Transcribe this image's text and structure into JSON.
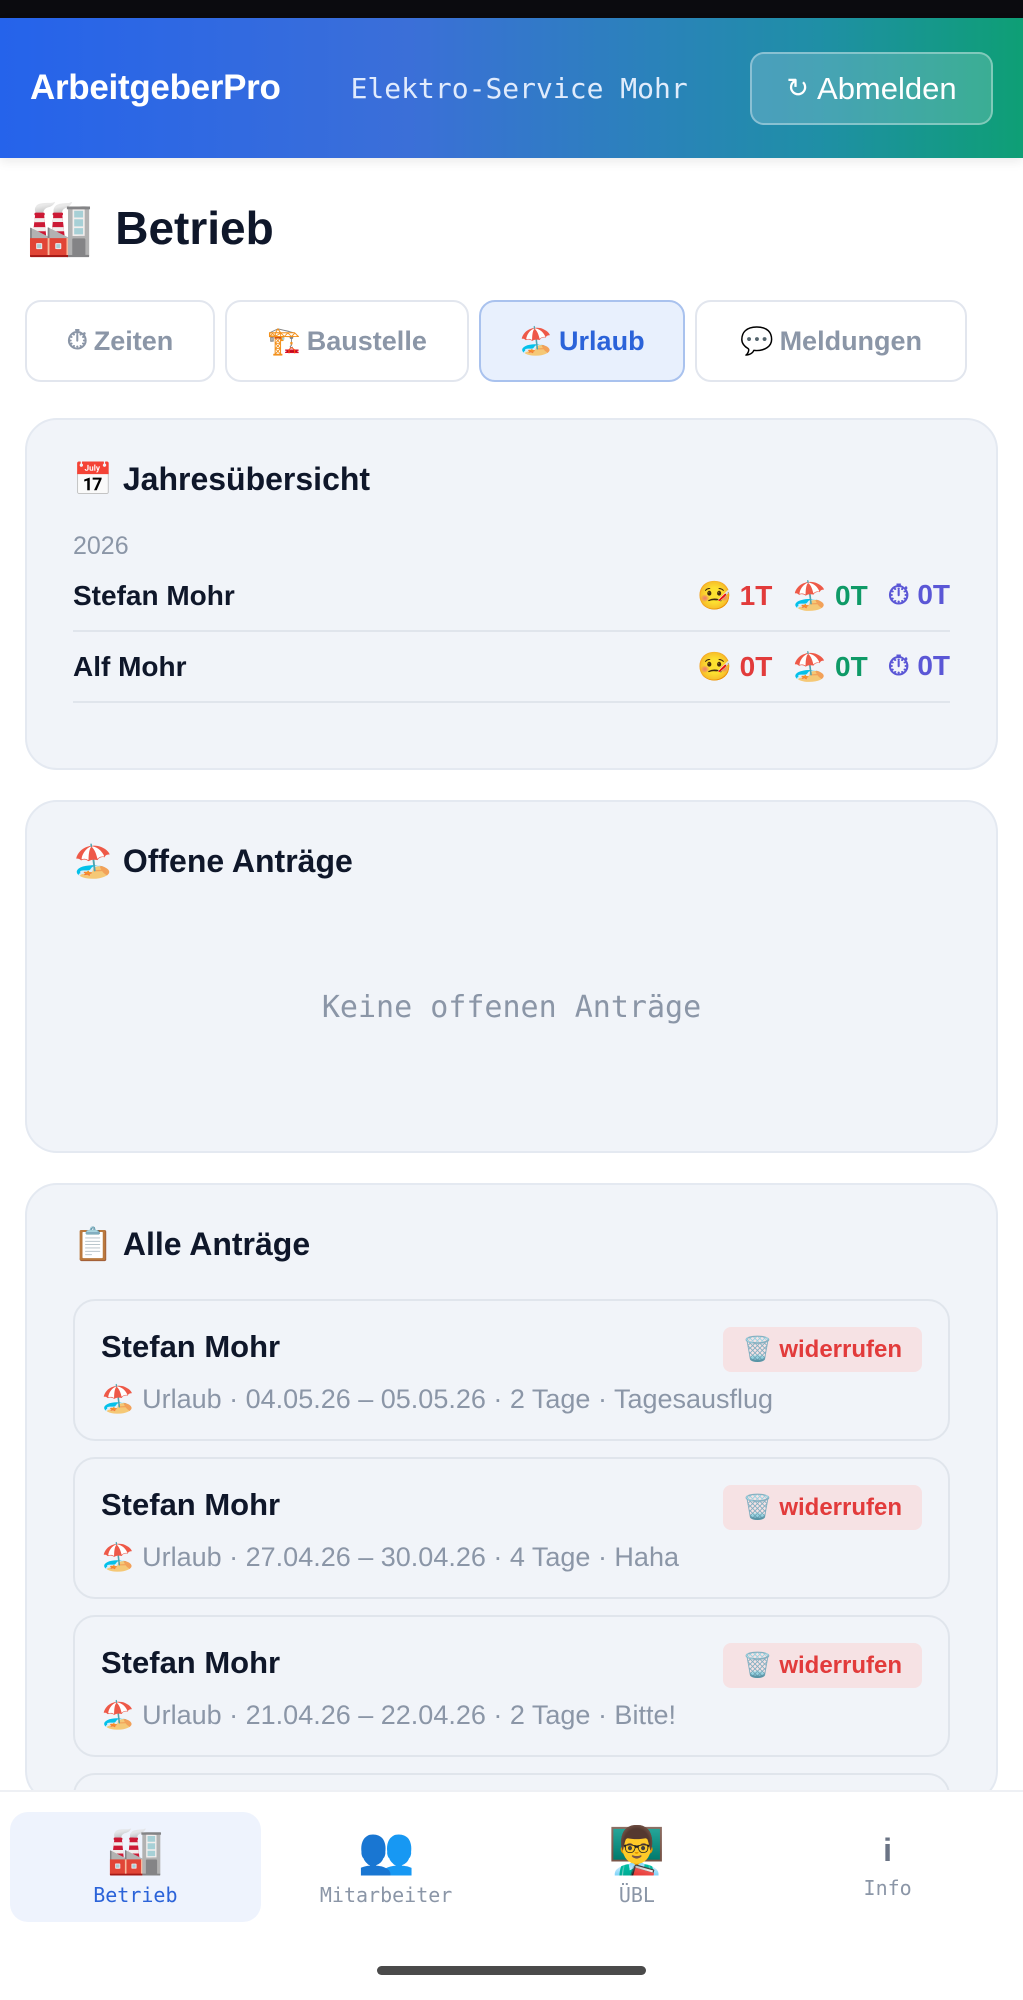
{
  "header": {
    "brand": "ArbeitgeberPro",
    "company": "Elektro-Service Mohr",
    "logout_label": "Abmelden",
    "logout_icon": "↻"
  },
  "page": {
    "icon": "🏭",
    "title": "Betrieb"
  },
  "tabs": [
    {
      "icon": "⏱",
      "label": "Zeiten",
      "active": false
    },
    {
      "icon": "🏗️",
      "label": "Baustelle",
      "active": false
    },
    {
      "icon": "🏖️",
      "label": "Urlaub",
      "active": true
    },
    {
      "icon": "💬",
      "label": "Meldungen",
      "active": false
    }
  ],
  "overview": {
    "icon": "📅",
    "title": "Jahresübersicht",
    "year": "2026",
    "employees": [
      {
        "name": "Stefan Mohr",
        "sick": "1T",
        "vacation": "0T",
        "overtime": "0T"
      },
      {
        "name": "Alf Mohr",
        "sick": "0T",
        "vacation": "0T",
        "overtime": "0T"
      }
    ],
    "sick_icon": "🤒",
    "vacation_icon": "🏖️",
    "overtime_icon": "⏱"
  },
  "open_requests": {
    "icon": "🏖️",
    "title": "Offene Anträge",
    "empty_text": "Keine offenen Anträge"
  },
  "all_requests": {
    "icon": "📋",
    "title": "Alle Anträge",
    "revoke_label": "🗑️ widerrufen",
    "items": [
      {
        "name": "Stefan Mohr",
        "detail": "🏖️ Urlaub · 04.05.26 – 05.05.26 · 2 Tage · Tagesausflug"
      },
      {
        "name": "Stefan Mohr",
        "detail": "🏖️ Urlaub · 27.04.26 – 30.04.26 · 4 Tage · Haha"
      },
      {
        "name": "Stefan Mohr",
        "detail": "🏖️ Urlaub · 21.04.26 – 22.04.26 · 2 Tage · Bitte!"
      }
    ]
  },
  "bottom_nav": [
    {
      "icon": "🏭",
      "label": "Betrieb",
      "active": true
    },
    {
      "icon": "👥",
      "label": "Mitarbeiter",
      "active": false
    },
    {
      "icon": "👨‍🏫",
      "label": "ÜBL",
      "active": false
    },
    {
      "icon": "i",
      "label": "Info",
      "active": false
    }
  ]
}
